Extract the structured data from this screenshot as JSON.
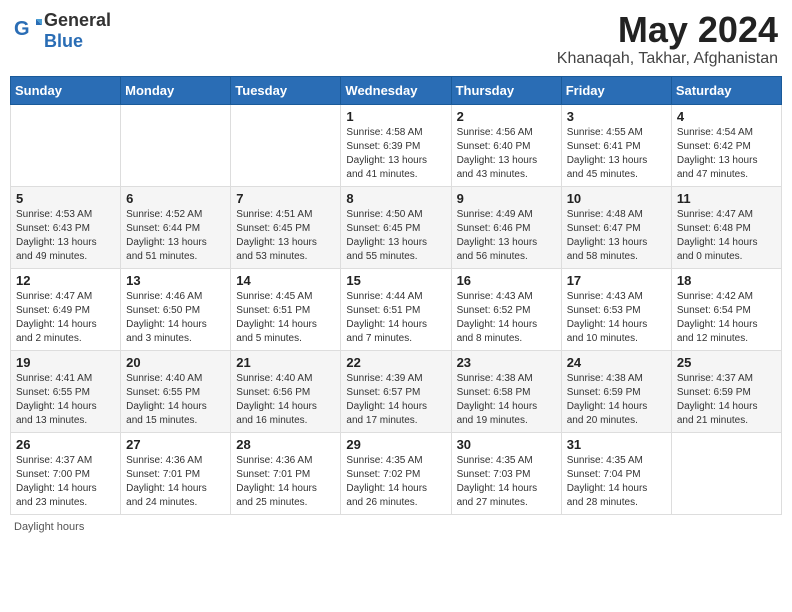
{
  "header": {
    "logo_general": "General",
    "logo_blue": "Blue",
    "month_title": "May 2024",
    "location": "Khanaqah, Takhar, Afghanistan"
  },
  "days_of_week": [
    "Sunday",
    "Monday",
    "Tuesday",
    "Wednesday",
    "Thursday",
    "Friday",
    "Saturday"
  ],
  "weeks": [
    [
      {
        "day": "",
        "sunrise": "",
        "sunset": "",
        "daylight": ""
      },
      {
        "day": "",
        "sunrise": "",
        "sunset": "",
        "daylight": ""
      },
      {
        "day": "",
        "sunrise": "",
        "sunset": "",
        "daylight": ""
      },
      {
        "day": "1",
        "sunrise": "Sunrise: 4:58 AM",
        "sunset": "Sunset: 6:39 PM",
        "daylight": "Daylight: 13 hours and 41 minutes."
      },
      {
        "day": "2",
        "sunrise": "Sunrise: 4:56 AM",
        "sunset": "Sunset: 6:40 PM",
        "daylight": "Daylight: 13 hours and 43 minutes."
      },
      {
        "day": "3",
        "sunrise": "Sunrise: 4:55 AM",
        "sunset": "Sunset: 6:41 PM",
        "daylight": "Daylight: 13 hours and 45 minutes."
      },
      {
        "day": "4",
        "sunrise": "Sunrise: 4:54 AM",
        "sunset": "Sunset: 6:42 PM",
        "daylight": "Daylight: 13 hours and 47 minutes."
      }
    ],
    [
      {
        "day": "5",
        "sunrise": "Sunrise: 4:53 AM",
        "sunset": "Sunset: 6:43 PM",
        "daylight": "Daylight: 13 hours and 49 minutes."
      },
      {
        "day": "6",
        "sunrise": "Sunrise: 4:52 AM",
        "sunset": "Sunset: 6:44 PM",
        "daylight": "Daylight: 13 hours and 51 minutes."
      },
      {
        "day": "7",
        "sunrise": "Sunrise: 4:51 AM",
        "sunset": "Sunset: 6:45 PM",
        "daylight": "Daylight: 13 hours and 53 minutes."
      },
      {
        "day": "8",
        "sunrise": "Sunrise: 4:50 AM",
        "sunset": "Sunset: 6:45 PM",
        "daylight": "Daylight: 13 hours and 55 minutes."
      },
      {
        "day": "9",
        "sunrise": "Sunrise: 4:49 AM",
        "sunset": "Sunset: 6:46 PM",
        "daylight": "Daylight: 13 hours and 56 minutes."
      },
      {
        "day": "10",
        "sunrise": "Sunrise: 4:48 AM",
        "sunset": "Sunset: 6:47 PM",
        "daylight": "Daylight: 13 hours and 58 minutes."
      },
      {
        "day": "11",
        "sunrise": "Sunrise: 4:47 AM",
        "sunset": "Sunset: 6:48 PM",
        "daylight": "Daylight: 14 hours and 0 minutes."
      }
    ],
    [
      {
        "day": "12",
        "sunrise": "Sunrise: 4:47 AM",
        "sunset": "Sunset: 6:49 PM",
        "daylight": "Daylight: 14 hours and 2 minutes."
      },
      {
        "day": "13",
        "sunrise": "Sunrise: 4:46 AM",
        "sunset": "Sunset: 6:50 PM",
        "daylight": "Daylight: 14 hours and 3 minutes."
      },
      {
        "day": "14",
        "sunrise": "Sunrise: 4:45 AM",
        "sunset": "Sunset: 6:51 PM",
        "daylight": "Daylight: 14 hours and 5 minutes."
      },
      {
        "day": "15",
        "sunrise": "Sunrise: 4:44 AM",
        "sunset": "Sunset: 6:51 PM",
        "daylight": "Daylight: 14 hours and 7 minutes."
      },
      {
        "day": "16",
        "sunrise": "Sunrise: 4:43 AM",
        "sunset": "Sunset: 6:52 PM",
        "daylight": "Daylight: 14 hours and 8 minutes."
      },
      {
        "day": "17",
        "sunrise": "Sunrise: 4:43 AM",
        "sunset": "Sunset: 6:53 PM",
        "daylight": "Daylight: 14 hours and 10 minutes."
      },
      {
        "day": "18",
        "sunrise": "Sunrise: 4:42 AM",
        "sunset": "Sunset: 6:54 PM",
        "daylight": "Daylight: 14 hours and 12 minutes."
      }
    ],
    [
      {
        "day": "19",
        "sunrise": "Sunrise: 4:41 AM",
        "sunset": "Sunset: 6:55 PM",
        "daylight": "Daylight: 14 hours and 13 minutes."
      },
      {
        "day": "20",
        "sunrise": "Sunrise: 4:40 AM",
        "sunset": "Sunset: 6:55 PM",
        "daylight": "Daylight: 14 hours and 15 minutes."
      },
      {
        "day": "21",
        "sunrise": "Sunrise: 4:40 AM",
        "sunset": "Sunset: 6:56 PM",
        "daylight": "Daylight: 14 hours and 16 minutes."
      },
      {
        "day": "22",
        "sunrise": "Sunrise: 4:39 AM",
        "sunset": "Sunset: 6:57 PM",
        "daylight": "Daylight: 14 hours and 17 minutes."
      },
      {
        "day": "23",
        "sunrise": "Sunrise: 4:38 AM",
        "sunset": "Sunset: 6:58 PM",
        "daylight": "Daylight: 14 hours and 19 minutes."
      },
      {
        "day": "24",
        "sunrise": "Sunrise: 4:38 AM",
        "sunset": "Sunset: 6:59 PM",
        "daylight": "Daylight: 14 hours and 20 minutes."
      },
      {
        "day": "25",
        "sunrise": "Sunrise: 4:37 AM",
        "sunset": "Sunset: 6:59 PM",
        "daylight": "Daylight: 14 hours and 21 minutes."
      }
    ],
    [
      {
        "day": "26",
        "sunrise": "Sunrise: 4:37 AM",
        "sunset": "Sunset: 7:00 PM",
        "daylight": "Daylight: 14 hours and 23 minutes."
      },
      {
        "day": "27",
        "sunrise": "Sunrise: 4:36 AM",
        "sunset": "Sunset: 7:01 PM",
        "daylight": "Daylight: 14 hours and 24 minutes."
      },
      {
        "day": "28",
        "sunrise": "Sunrise: 4:36 AM",
        "sunset": "Sunset: 7:01 PM",
        "daylight": "Daylight: 14 hours and 25 minutes."
      },
      {
        "day": "29",
        "sunrise": "Sunrise: 4:35 AM",
        "sunset": "Sunset: 7:02 PM",
        "daylight": "Daylight: 14 hours and 26 minutes."
      },
      {
        "day": "30",
        "sunrise": "Sunrise: 4:35 AM",
        "sunset": "Sunset: 7:03 PM",
        "daylight": "Daylight: 14 hours and 27 minutes."
      },
      {
        "day": "31",
        "sunrise": "Sunrise: 4:35 AM",
        "sunset": "Sunset: 7:04 PM",
        "daylight": "Daylight: 14 hours and 28 minutes."
      },
      {
        "day": "",
        "sunrise": "",
        "sunset": "",
        "daylight": ""
      }
    ]
  ],
  "footer": {
    "daylight_label": "Daylight hours"
  }
}
